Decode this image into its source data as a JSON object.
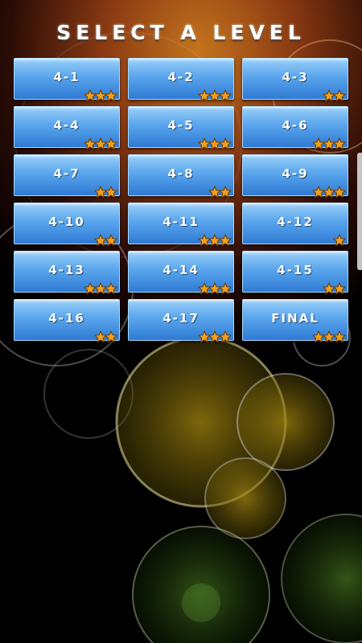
{
  "screen": {
    "title": "SELECT A LEVEL"
  },
  "colors": {
    "tile_top": "#c4e4ff",
    "tile_bottom": "#2e7ad3",
    "star_fill": "#f0a020",
    "star_outline": "#6a3a00"
  },
  "icons": {
    "star": "star-icon"
  },
  "levels": [
    {
      "label": "4-1",
      "stars": 3
    },
    {
      "label": "4-2",
      "stars": 3
    },
    {
      "label": "4-3",
      "stars": 2
    },
    {
      "label": "4-4",
      "stars": 3
    },
    {
      "label": "4-5",
      "stars": 3
    },
    {
      "label": "4-6",
      "stars": 3
    },
    {
      "label": "4-7",
      "stars": 2
    },
    {
      "label": "4-8",
      "stars": 2
    },
    {
      "label": "4-9",
      "stars": 3
    },
    {
      "label": "4-10",
      "stars": 2
    },
    {
      "label": "4-11",
      "stars": 3
    },
    {
      "label": "4-12",
      "stars": 1
    },
    {
      "label": "4-13",
      "stars": 3
    },
    {
      "label": "4-14",
      "stars": 3
    },
    {
      "label": "4-15",
      "stars": 2
    },
    {
      "label": "4-16",
      "stars": 2
    },
    {
      "label": "4-17",
      "stars": 3
    },
    {
      "label": "FINAL",
      "stars": 3
    }
  ]
}
